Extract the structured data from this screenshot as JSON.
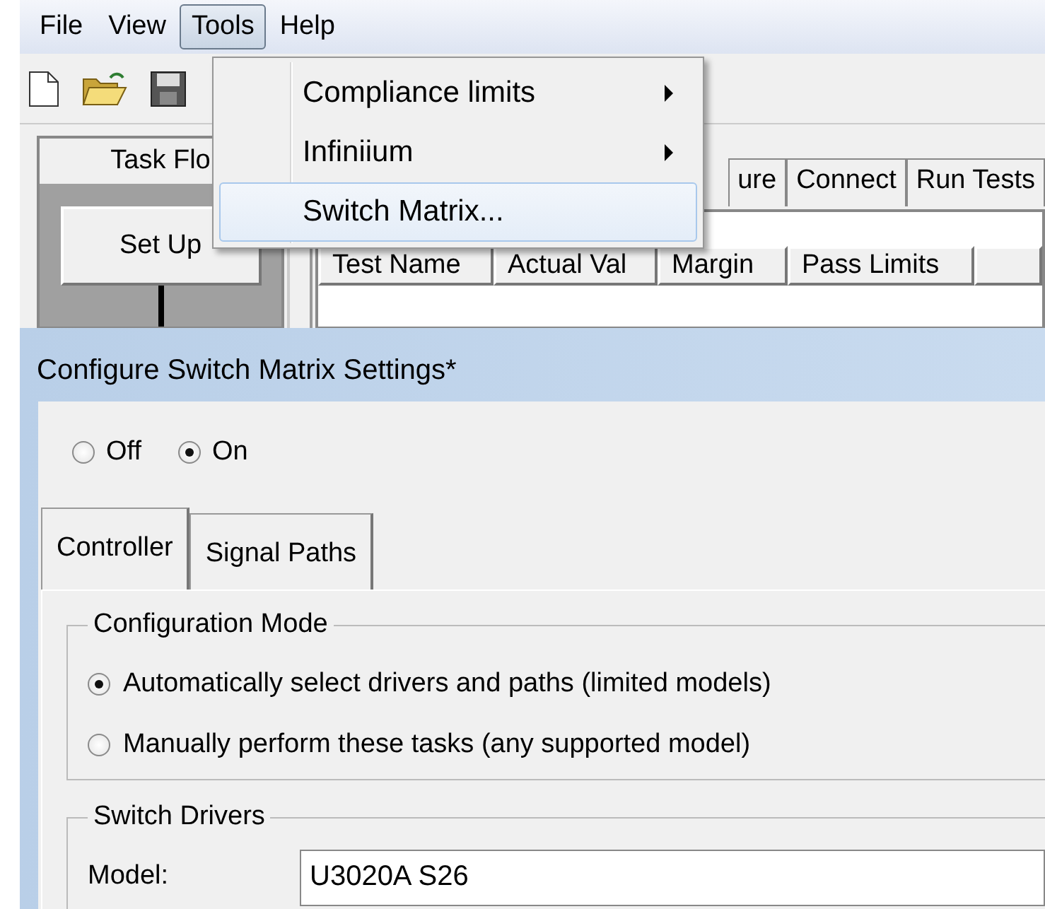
{
  "menubar": [
    {
      "label": "File",
      "selected": false
    },
    {
      "label": "View",
      "selected": false
    },
    {
      "label": "Tools",
      "selected": true
    },
    {
      "label": "Help",
      "selected": false
    }
  ],
  "task_flow": {
    "title": "Task Flo",
    "button": "Set Up"
  },
  "tabs": [
    {
      "label": "ure"
    },
    {
      "label": "Connect"
    },
    {
      "label": "Run Tests"
    }
  ],
  "results_table": {
    "columns": [
      "Test Name",
      "Actual Val",
      "Margin",
      "Pass Limits"
    ]
  },
  "tools_menu": [
    {
      "label": "Compliance limits",
      "submenu": true,
      "selected": false
    },
    {
      "label": "Infiniium",
      "submenu": true,
      "selected": false
    },
    {
      "label": "Switch Matrix...",
      "submenu": false,
      "selected": true
    }
  ],
  "dialog": {
    "title": "Configure Switch Matrix Settings*",
    "power": [
      {
        "label": "Off",
        "selected": false
      },
      {
        "label": "On",
        "selected": true
      }
    ],
    "tabs": [
      {
        "label": "Controller",
        "selected": true
      },
      {
        "label": "Signal Paths",
        "selected": false
      }
    ],
    "configuration_mode": {
      "title": "Configuration Mode",
      "options": [
        {
          "label": "Automatically select drivers and paths (limited models)",
          "selected": true
        },
        {
          "label": "Manually perform these tasks (any supported model)",
          "selected": false
        }
      ]
    },
    "switch_drivers": {
      "title": "Switch Drivers",
      "model_label": "Model:",
      "model_value": "U3020A S26"
    }
  }
}
